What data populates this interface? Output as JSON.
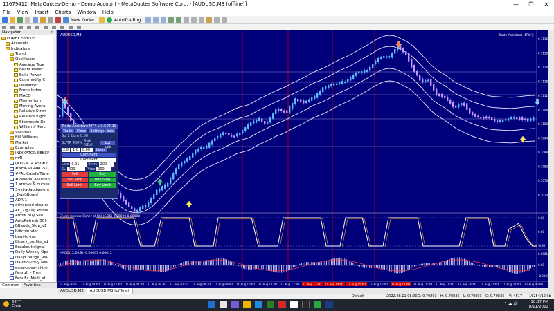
{
  "window": {
    "title": "11679412: MetaQuotes-Demo - Demo Account - MetaQuotes Software Corp. - [AUDUSD,M3 (offline)]",
    "controls": [
      "—",
      "❐",
      "✕"
    ]
  },
  "menu": {
    "items": [
      "File",
      "View",
      "Insert",
      "Charts",
      "Window",
      "Help"
    ]
  },
  "toolbar": {
    "new_order_label": "New Order",
    "autotrading_label": "AutoTrading"
  },
  "navigator": {
    "title": "Navigator",
    "items": [
      {
        "label": "FOREX.com US",
        "icon": "folder",
        "indent": 0
      },
      {
        "label": "Accounts",
        "icon": "folder",
        "indent": 1
      },
      {
        "label": "Indicators",
        "icon": "folder",
        "indent": 1
      },
      {
        "label": "Trend",
        "icon": "folder",
        "indent": 2
      },
      {
        "label": "Oscillators",
        "icon": "folder",
        "indent": 2
      },
      {
        "label": "Average True",
        "icon": "ind",
        "indent": 3
      },
      {
        "label": "Bears Power",
        "icon": "ind",
        "indent": 3
      },
      {
        "label": "Bulls Power",
        "icon": "ind",
        "indent": 3
      },
      {
        "label": "Commodity C",
        "icon": "ind",
        "indent": 3
      },
      {
        "label": "DeMarker",
        "icon": "ind",
        "indent": 3
      },
      {
        "label": "Force Index",
        "icon": "ind",
        "indent": 3
      },
      {
        "label": "MACD",
        "icon": "ind",
        "indent": 3
      },
      {
        "label": "Momentum",
        "icon": "ind",
        "indent": 3
      },
      {
        "label": "Moving Avera",
        "icon": "ind",
        "indent": 3
      },
      {
        "label": "Relative Stren",
        "icon": "ind",
        "indent": 3
      },
      {
        "label": "Relative Vigor",
        "icon": "ind",
        "indent": 3
      },
      {
        "label": "Stochastic Os",
        "icon": "ind",
        "indent": 3
      },
      {
        "label": "Williams' Perc",
        "icon": "ind",
        "indent": 3
      },
      {
        "label": "Volumes",
        "icon": "folder",
        "indent": 2
      },
      {
        "label": "Bill Williams",
        "icon": "folder",
        "indent": 2
      },
      {
        "label": "Market",
        "icon": "folder",
        "indent": 2
      },
      {
        "label": "Examples",
        "icon": "folder",
        "indent": 2
      },
      {
        "label": "INDIKATOR SEBCF",
        "icon": "folder",
        "indent": 2
      },
      {
        "label": "m4l",
        "icon": "folder",
        "indent": 2
      },
      {
        "label": "(X10-MT4 RSI #2",
        "icon": "prog",
        "indent": 2
      },
      {
        "label": "#NEX-SIGNAL-ST(",
        "icon": "prog",
        "indent": 2
      },
      {
        "label": "#PAL CandleTime",
        "icon": "prog",
        "indent": 2
      },
      {
        "label": "#Palleda_Assisten",
        "icon": "prog",
        "indent": 2
      },
      {
        "label": "1 arrows & curves",
        "icon": "prog",
        "indent": 2
      },
      {
        "label": "3-rsi-adaptive-em",
        "icon": "prog",
        "indent": 2
      },
      {
        "label": "_DashBoard",
        "icon": "prog",
        "indent": 2
      },
      {
        "label": "ADR 1",
        "icon": "prog",
        "indent": 2
      },
      {
        "label": "advanced-step-rs",
        "icon": "prog",
        "indent": 2
      },
      {
        "label": "AK_ZigZag Pointe",
        "icon": "prog",
        "indent": 2
      },
      {
        "label": "Arrow Buy Sell",
        "icon": "prog",
        "indent": 2
      },
      {
        "label": "AutoRefresh 509",
        "icon": "prog",
        "indent": 2
      },
      {
        "label": "BBands_Stop_v1",
        "icon": "prog",
        "indent": 2
      },
      {
        "label": "bdfchinnder",
        "icon": "prog",
        "indent": 2
      },
      {
        "label": "bepi-to-mc",
        "icon": "prog",
        "indent": 2
      },
      {
        "label": "Binary_profits_ad",
        "icon": "prog",
        "indent": 2
      },
      {
        "label": "Breakout signal",
        "icon": "prog",
        "indent": 2
      },
      {
        "label": "Daily-Weekly Ope",
        "icon": "prog",
        "indent": 2
      },
      {
        "label": "DailyChange_Rev",
        "icon": "prog",
        "indent": 2
      },
      {
        "label": "DaVinci-Truly Nev",
        "icon": "prog",
        "indent": 2
      },
      {
        "label": "ema-cross-rsi-tre",
        "icon": "prog",
        "indent": 2
      },
      {
        "label": "Fenrufr - Tren",
        "icon": "prog",
        "indent": 2
      },
      {
        "label": "FenuFx_Multi_st",
        "icon": "prog",
        "indent": 2
      },
      {
        "label": "ForexProfitSuprer",
        "icon": "prog",
        "indent": 2
      }
    ],
    "tabs": [
      "Common",
      "Favorites"
    ]
  },
  "chart": {
    "symbol_label": "AUDUSD,M3",
    "trade_assistant_label": "Trade Assistant MT4 ⓘ",
    "sub1_label": "Ehlers Inverse Fisher of RSI (5,15) 0.80000 0.00000",
    "sub2_label": "MACD(12,26,9) -0.00003 0.00012",
    "price_labels": [
      "0.71360",
      "0.71300",
      "0.71240",
      "0.71180",
      "0.71120",
      "0.71060",
      "0.71000",
      "0.70940",
      "0.70880",
      "0.70820",
      "0.70760",
      "0.70700"
    ],
    "sub1_scale": [
      "0.80",
      "0.00",
      "-0.80"
    ],
    "sub2_scale": [
      "0.00012",
      "0.00",
      "-0.00030"
    ],
    "time_labels": [
      "10 Aug 2022",
      "11 Aug 14:00",
      "11 Aug 15:00",
      "11 Aug 01:18",
      "11 Aug 04:30",
      "11 Aug 07:30",
      "11 Aug 08:30",
      "11 Aug 09:00",
      "11 Aug 10:00",
      "11 Aug 11:00",
      "11 Aug 12:00",
      "11 Aug 13:00",
      "11 Aug 14:00",
      "11 Aug 15:00",
      "11 Aug 16:00",
      "11 Aug 17:00",
      "11 Aug 18:00",
      "11 Aug 19:00",
      "11 Aug 20:00",
      "11 Aug 21:00",
      "11 Aug 22:00",
      "12 Aug 00:00"
    ]
  },
  "trade_panel": {
    "title": "Trade Assistant MT4 v 3.5",
    "header_right": "07:19",
    "tabs": [
      "Trade",
      "Close",
      "Settings",
      "Info"
    ],
    "sp_label": "Sp",
    "sp_value": "1",
    "com_label": "Com",
    "com_value": "0.00",
    "sltp_label": "SL/TP",
    "sltp_value": "400%",
    "risk_label": "Risk %Bal",
    "lot_calc_label": "Lot calc",
    "sltp_inputs": [
      "2.0",
      "1.0"
    ],
    "risk_value": "0.00",
    "lines_label": "Lines",
    "comment_header": "Comment",
    "comment_value": "Comment",
    "lots_label": "Lots",
    "lots_value": "0.01",
    "entry_label": "Entry",
    "entry_value": "200",
    "sl_label": "SL",
    "sl_value": "400",
    "price_label": "Price",
    "tp_value": "200",
    "sell_label": "Sell",
    "buy_label": "Buy",
    "sell_stop_label": "Sell Stop",
    "buy_stop_label": "Buy Stop",
    "sell_limit_label": "Sell Limit",
    "buy_limit_label": "Buy Limit"
  },
  "chart_tabs": [
    "AUDUSD,M3",
    "AUDUSD,M3 (offline)"
  ],
  "status": {
    "profile": "Default",
    "datetime": "2022.08.11 08:00",
    "open": "O: 0.70803",
    "high": "H: 0.70836",
    "low": "L: 0.70803",
    "close": "C: 0.70836",
    "volume": "V: 4517",
    "traffic": "16254/12 kb"
  },
  "taskbar": {
    "temp": "62°F",
    "condition": "Clear",
    "time": "10:37 PM",
    "date": "8/11/2022"
  },
  "colors": {
    "chart_bg": "#00007a",
    "bull_candle": "#5fb8ff",
    "bear_candle": "#c29aff",
    "band_line": "#e8e8ff",
    "session_line": "#d00000",
    "sell": "#e33a3a",
    "buy": "#1db33a"
  }
}
